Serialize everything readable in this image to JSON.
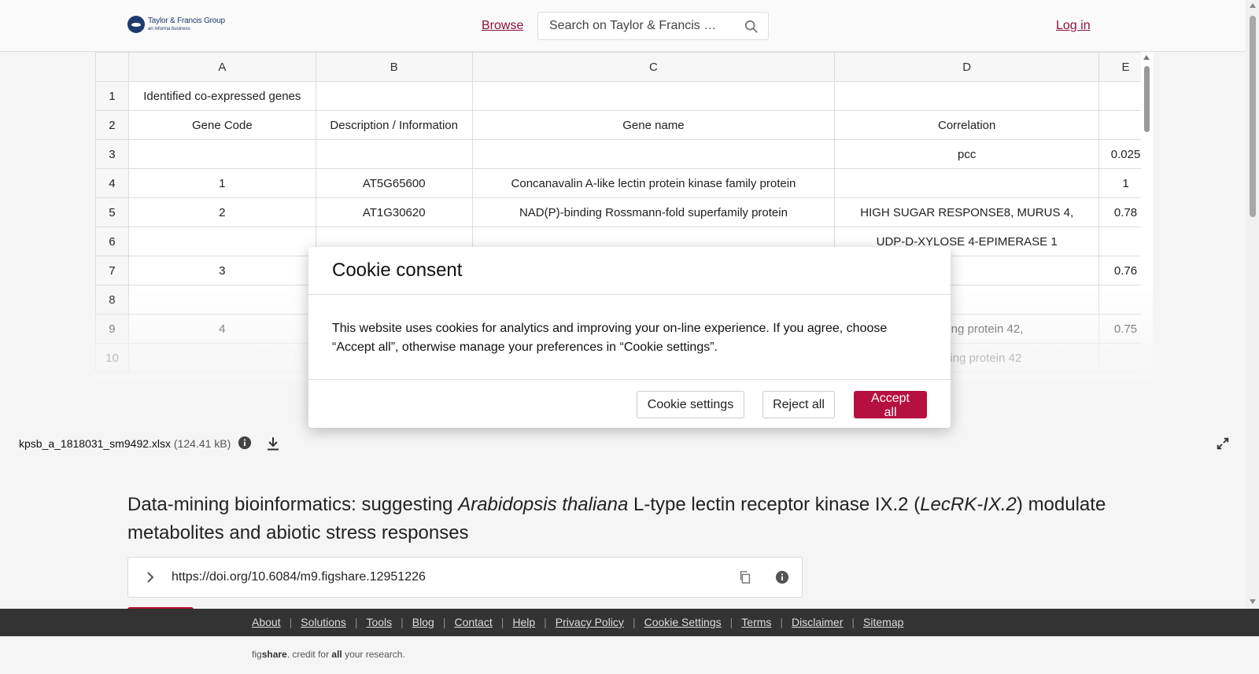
{
  "header": {
    "logo_main": "Taylor & Francis Group",
    "logo_sub": "an informa business",
    "browse_label": "Browse",
    "search_placeholder": "Search on Taylor & Francis …",
    "login_label": "Log in"
  },
  "spreadsheet": {
    "columns": [
      "A",
      "B",
      "C",
      "D",
      "E"
    ],
    "rows": [
      {
        "num": "1",
        "cells": [
          "Identified co-expressed genes",
          "",
          "",
          "",
          ""
        ]
      },
      {
        "num": "2",
        "cells": [
          "Gene Code",
          "Description / Information",
          "Gene name",
          "Correlation",
          ""
        ]
      },
      {
        "num": "3",
        "cells": [
          "",
          "",
          "",
          "pcc",
          "0.025"
        ]
      },
      {
        "num": "4",
        "cells": [
          "1",
          "AT5G65600",
          "Concanavalin A-like lectin protein kinase family protein",
          "",
          "1"
        ]
      },
      {
        "num": "5",
        "cells": [
          "2",
          "AT1G30620",
          "NAD(P)-binding Rossmann-fold superfamily protein",
          "HIGH SUGAR RESPONSE8, MURUS 4,",
          "0.78"
        ]
      },
      {
        "num": "6",
        "cells": [
          "",
          "",
          "",
          "UDP-D-XYLOSE 4-EPIMERASE 1",
          ""
        ]
      },
      {
        "num": "7",
        "cells": [
          "3",
          "",
          "",
          "",
          "0.76"
        ]
      },
      {
        "num": "8",
        "cells": [
          "",
          "",
          "",
          "",
          ""
        ]
      },
      {
        "num": "9",
        "cells": [
          "4",
          "",
          "",
          "containing protein 42,",
          "0.75"
        ]
      },
      {
        "num": "10",
        "cells": [
          "",
          "",
          "",
          "containing protein 42",
          ""
        ]
      }
    ]
  },
  "file": {
    "name": "kpsb_a_1818031_sm9492.xlsx",
    "size": "(124.41 kB)"
  },
  "article": {
    "title_part1": "Data-mining bioinformatics: suggesting ",
    "title_italic1": "Arabidopsis thaliana",
    "title_part2": " L-type lectin receptor kinase IX.2 (",
    "title_italic2": "LecRK-IX.2",
    "title_part3": ") modulate metabolites and abiotic stress responses",
    "doi": "https://doi.org/10.6084/m9.figshare.12951226"
  },
  "footer": {
    "links": [
      "About",
      "Solutions",
      "Tools",
      "Blog",
      "Contact",
      "Help",
      "Privacy Policy",
      "Cookie Settings",
      "Terms",
      "Disclaimer",
      "Sitemap"
    ],
    "tag_fig": "fig",
    "tag_share": "share",
    "tag_mid": ". credit for ",
    "tag_all": "all",
    "tag_end": " your research."
  },
  "cookie_modal": {
    "title": "Cookie consent",
    "body": "This website uses cookies for analytics and improving your on-line experience. If you agree, choose “Accept all”, otherwise manage your preferences in “Cookie settings”.",
    "settings_label": "Cookie settings",
    "reject_label": "Reject all",
    "accept_label": "Accept all"
  },
  "colors": {
    "brand_red": "#b5103f",
    "link_color": "#8a1238",
    "footer_bg": "#333333"
  }
}
